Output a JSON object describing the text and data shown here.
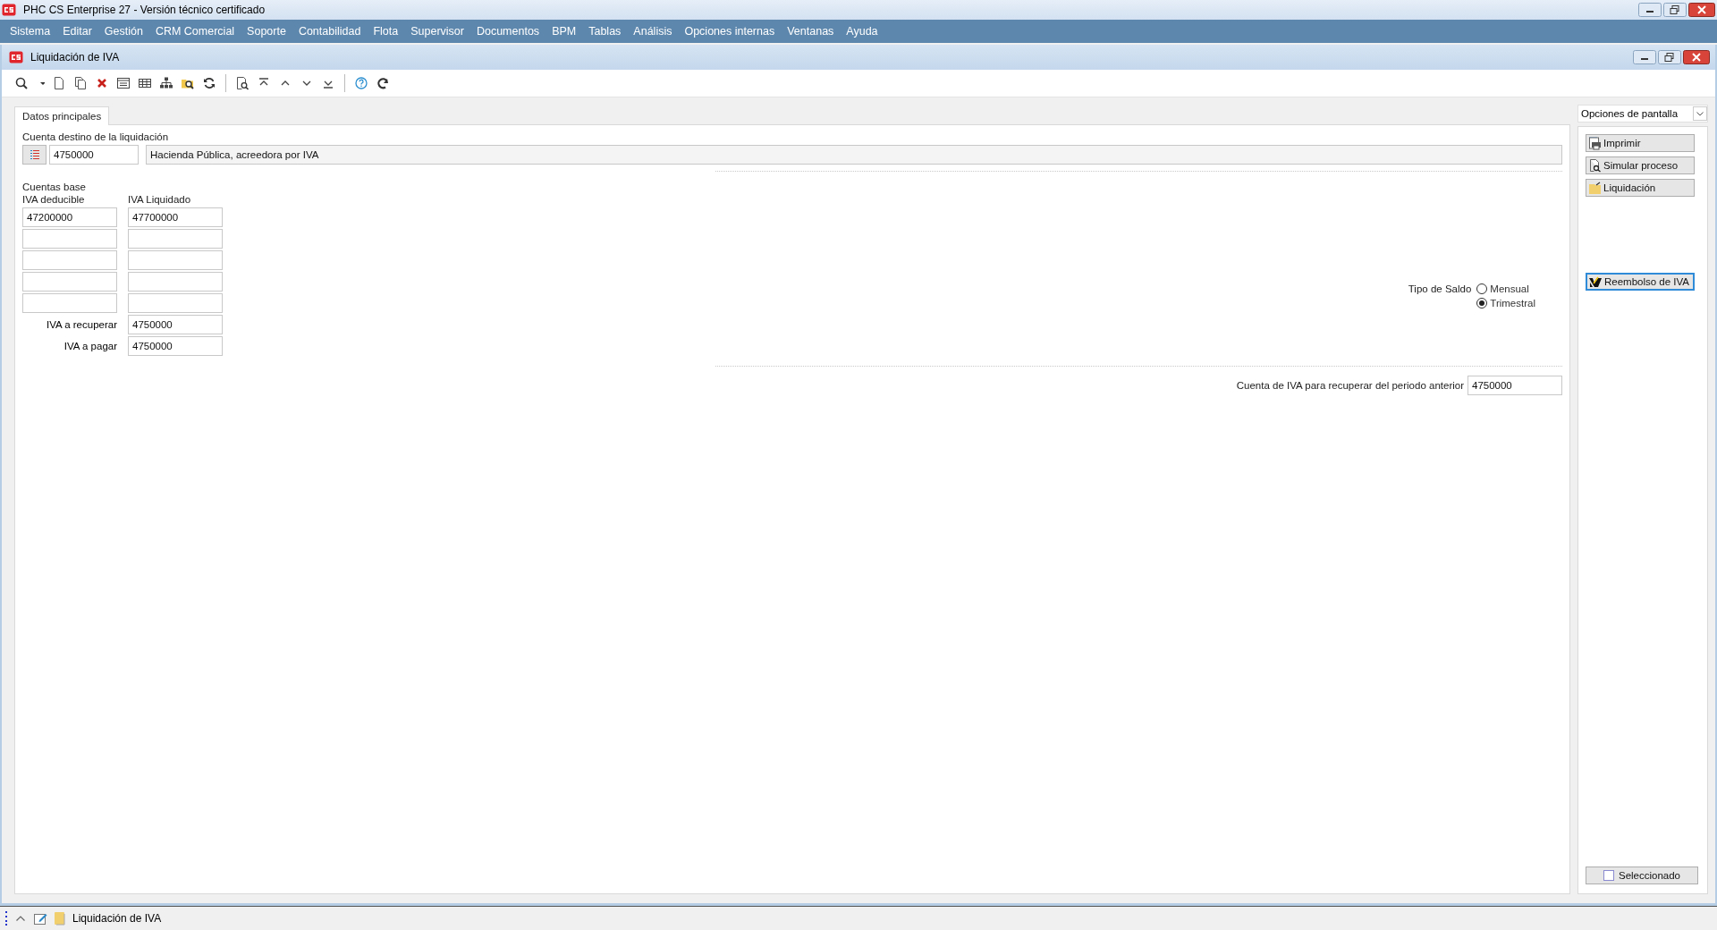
{
  "app": {
    "title": "PHC CS Enterprise 27 - Versión técnico certificado",
    "menu": [
      "Sistema",
      "Editar",
      "Gestión",
      "CRM Comercial",
      "Soporte",
      "Contabilidad",
      "Flota",
      "Supervisor",
      "Documentos",
      "BPM",
      "Tablas",
      "Análisis",
      "Opciones internas",
      "Ventanas",
      "Ayuda"
    ]
  },
  "window": {
    "title": "Liquidación de IVA"
  },
  "tabs": [
    {
      "label": "Datos principales",
      "selected": true
    }
  ],
  "form": {
    "destination_label": "Cuenta destino de la liquidación",
    "destination_account": "4750000",
    "destination_description": "Hacienda Pública, acreedora por IVA",
    "base_accounts_label": "Cuentas base",
    "columns": [
      "IVA deducible",
      "IVA Liquidado"
    ],
    "rows": [
      [
        "47200000",
        "47700000"
      ],
      [
        "",
        ""
      ],
      [
        "",
        ""
      ],
      [
        "",
        ""
      ],
      [
        "",
        ""
      ]
    ],
    "totals": [
      {
        "label": "IVA a recuperar",
        "value": "4750000"
      },
      {
        "label": "IVA a pagar",
        "value": "4750000"
      }
    ],
    "balance_type": {
      "label": "Tipo de Saldo",
      "options": [
        {
          "label": "Mensual",
          "selected": false
        },
        {
          "label": "Trimestral",
          "selected": true
        }
      ]
    },
    "previous_period": {
      "label": "Cuenta de IVA para recuperar del periodo anterior",
      "value": "4750000"
    }
  },
  "side_panel": {
    "dropdown": "Opciones de pantalla",
    "buttons": [
      {
        "label": "Imprimir",
        "kind": "print",
        "focused": false
      },
      {
        "label": "Simular proceso",
        "kind": "simulate",
        "focused": false
      },
      {
        "label": "Liquidación",
        "kind": "folder",
        "focused": false
      },
      {
        "label": "Reembolso de IVA",
        "kind": "refund",
        "focused": true
      }
    ],
    "selected_checkbox": {
      "label": "Seleccionado",
      "checked": false
    }
  },
  "taskbar": {
    "item": "Liquidación de IVA"
  }
}
